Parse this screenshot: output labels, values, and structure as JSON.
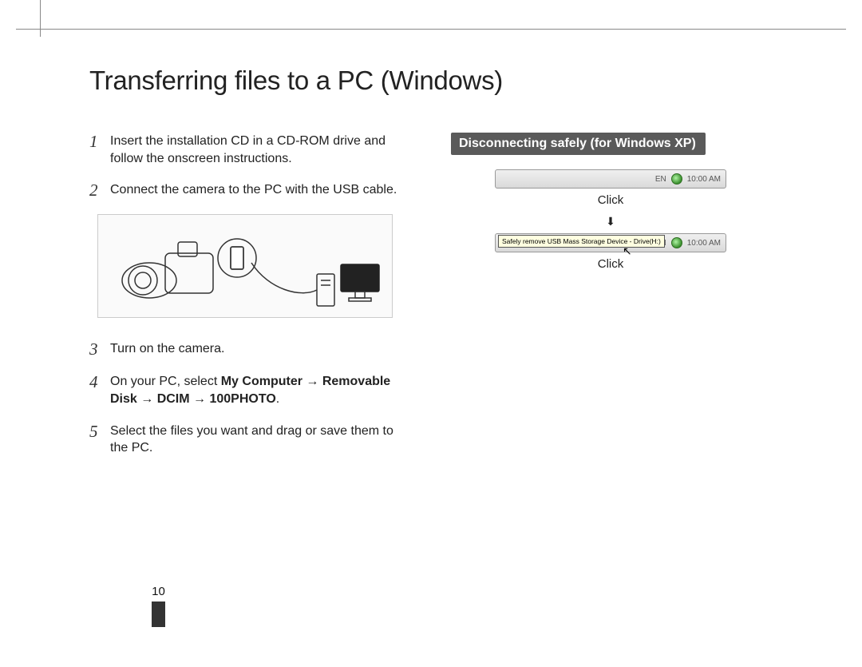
{
  "title": "Transferring files to a PC (Windows)",
  "steps": {
    "s1": {
      "num": "1",
      "text": "Insert the installation CD in a CD-ROM drive and follow the onscreen instructions."
    },
    "s2": {
      "num": "2",
      "text": "Connect the camera to the PC with the USB cable."
    },
    "s3": {
      "num": "3",
      "text": "Turn on the camera."
    },
    "s4": {
      "num": "4",
      "prefix": "On your PC, select ",
      "bold": "My Computer → Removable Disk → DCIM → 100PHOTO",
      "suffix": "."
    },
    "s5": {
      "num": "5",
      "text": "Select the files you want and drag or save them to the PC."
    }
  },
  "right": {
    "heading": "Disconnecting safely (for Windows XP)",
    "taskbar": {
      "lang": "EN",
      "time": "10:00 AM"
    },
    "click1": "Click",
    "arrow": "⬇",
    "tooltip": "Safely remove USB Mass Storage Device - Drive(H:)",
    "click2": "Click"
  },
  "page_number": "10"
}
